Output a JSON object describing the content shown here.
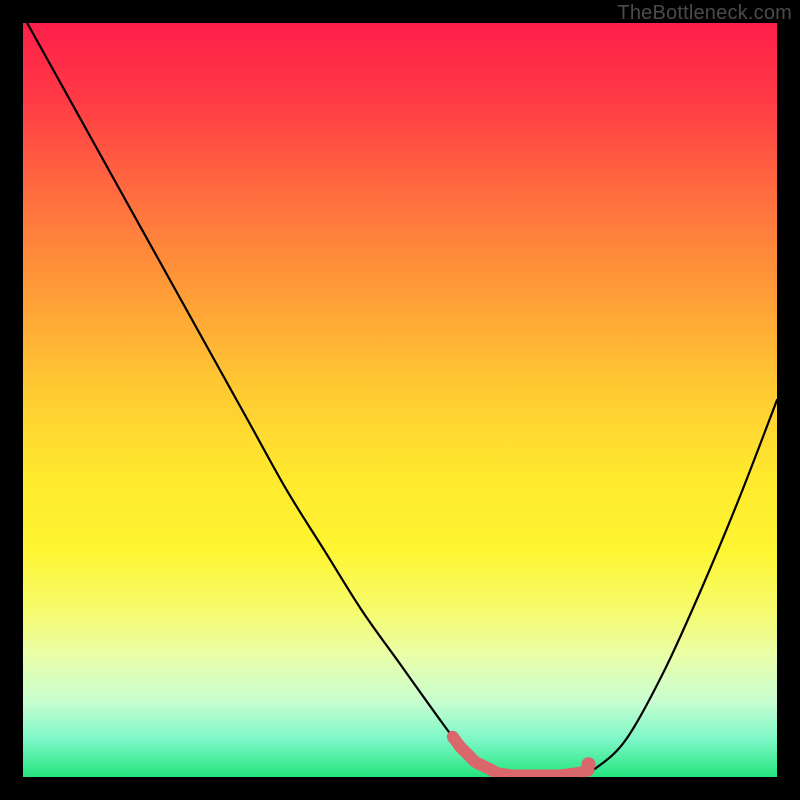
{
  "watermark": "TheBottleneck.com",
  "chart_data": {
    "type": "line",
    "title": "",
    "xlabel": "",
    "ylabel": "",
    "xlim": [
      0,
      100
    ],
    "ylim": [
      0,
      100
    ],
    "grid": false,
    "legend": null,
    "x": [
      0,
      5,
      10,
      15,
      20,
      25,
      30,
      35,
      40,
      45,
      50,
      55,
      58,
      60,
      63,
      66,
      70,
      72,
      74,
      76,
      80,
      85,
      90,
      95,
      100
    ],
    "values": [
      101,
      92,
      83,
      74,
      65,
      56,
      47,
      38,
      30,
      22,
      15,
      8,
      4,
      2,
      0.5,
      0,
      0,
      0.3,
      0.6,
      1.2,
      5,
      14,
      25,
      37,
      50
    ],
    "optimal_band_x": [
      57,
      75
    ],
    "optimal_y": 0.5,
    "series_color": "#000000",
    "highlight_color": "#d9676c"
  }
}
